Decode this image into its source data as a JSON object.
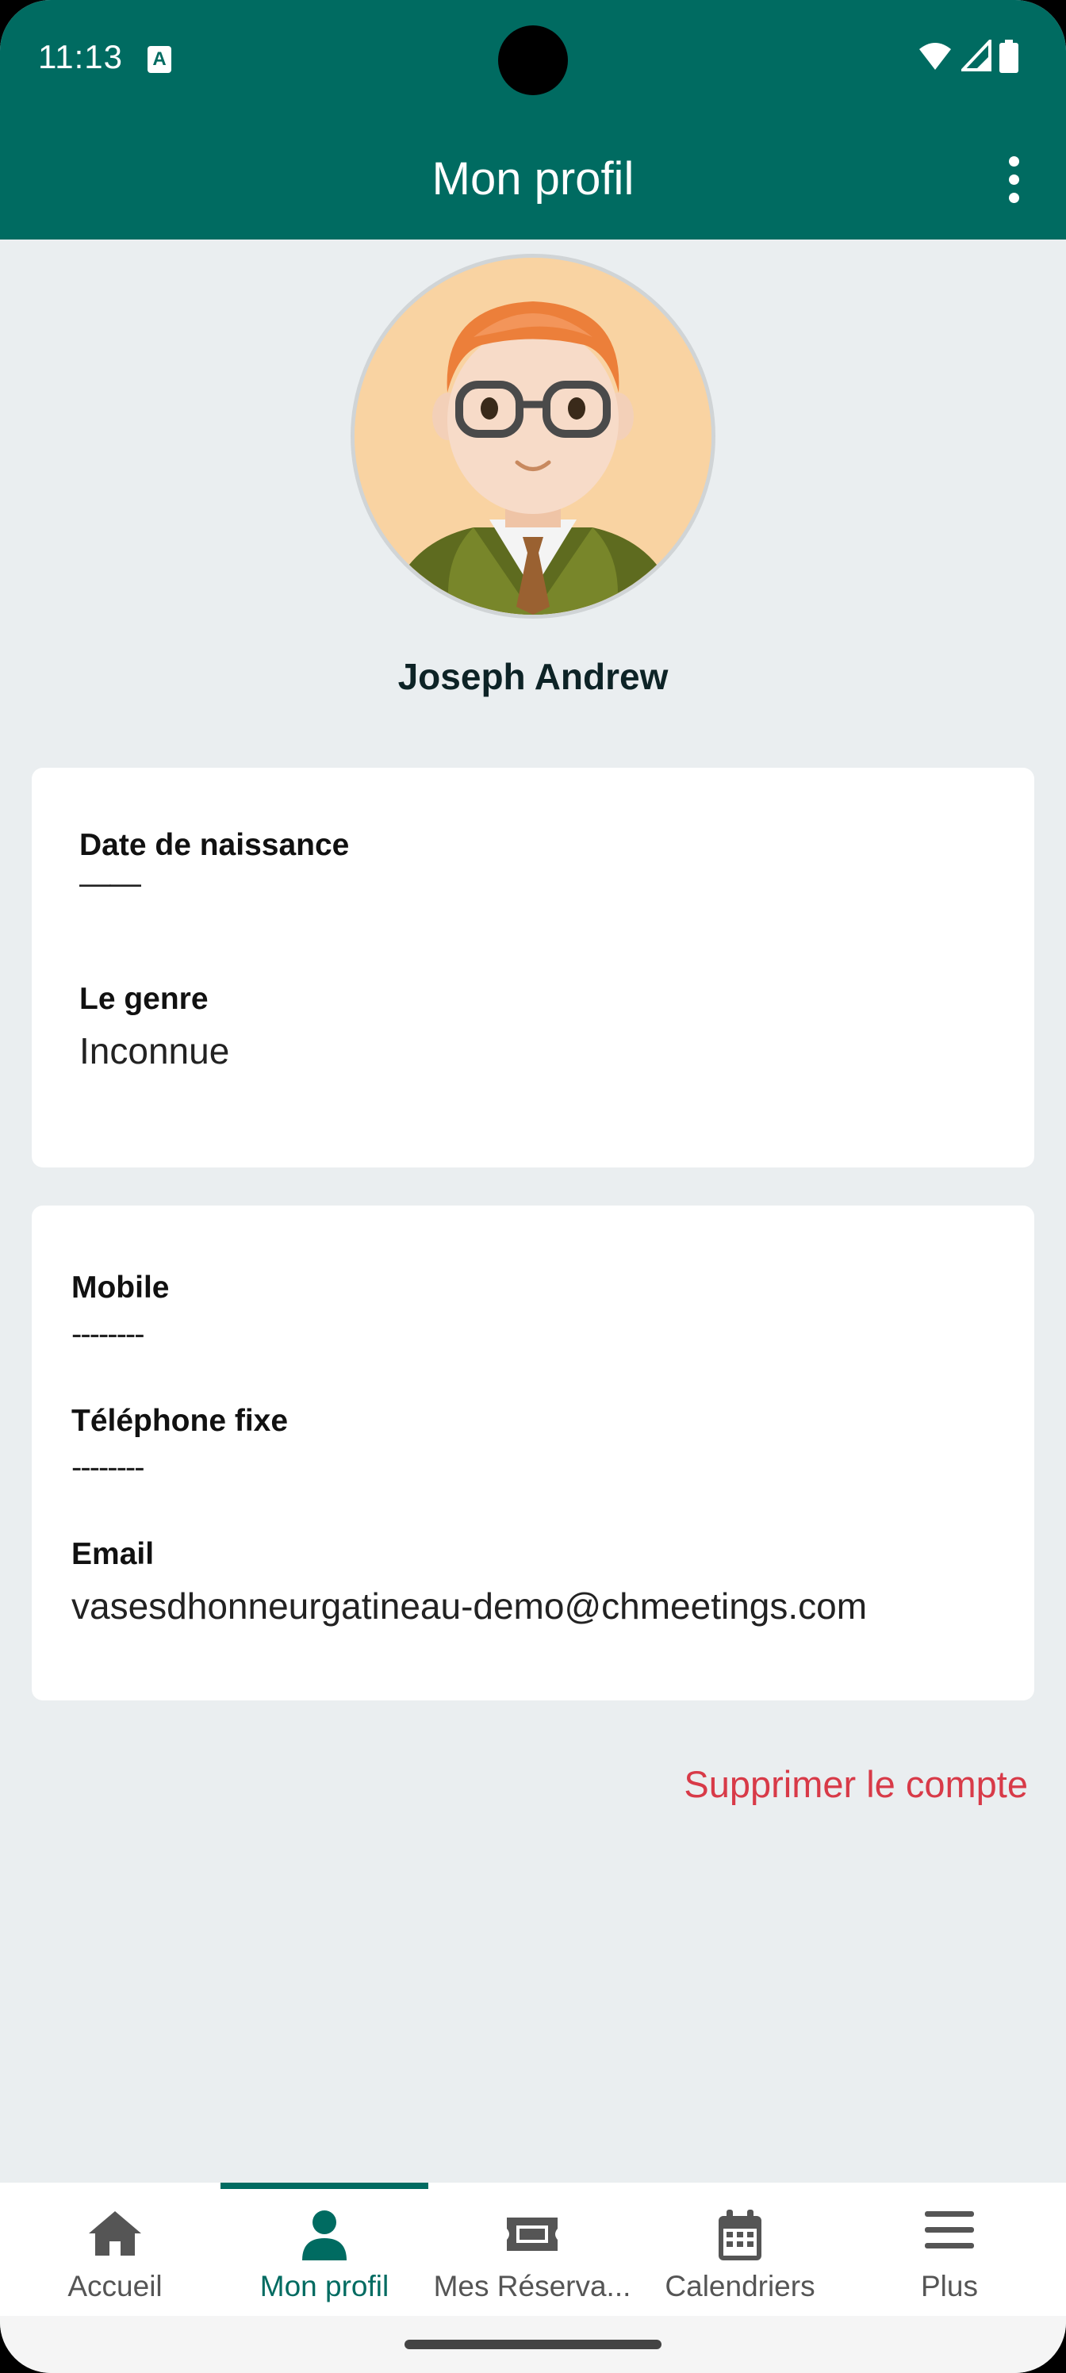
{
  "status_bar": {
    "time": "11:13",
    "notification_icon": "font-a-icon",
    "icons": [
      "wifi-icon",
      "signal-icon",
      "battery-icon"
    ]
  },
  "app_bar": {
    "title": "Mon profil",
    "menu_icon": "more-vert-icon"
  },
  "profile": {
    "name": "Joseph Andrew",
    "avatar": "avatar-illustration"
  },
  "card_personal": {
    "birth_label": "Date de naissance",
    "birth_value": "——",
    "gender_label": "Le genre",
    "gender_value": "Inconnue"
  },
  "card_contact": {
    "mobile_label": "Mobile",
    "mobile_value": "--------",
    "phone_label": "Téléphone fixe",
    "phone_value": "--------",
    "email_label": "Email",
    "email_value": "vasesdhonneurgatineau-demo@chmeetings.com"
  },
  "delete_account": "Supprimer le compte",
  "bottom_nav": {
    "items": [
      {
        "label": "Accueil",
        "icon": "home-icon"
      },
      {
        "label": "Mon profil",
        "icon": "person-icon"
      },
      {
        "label": "Mes Réserva...",
        "icon": "ticket-icon"
      },
      {
        "label": "Calendriers",
        "icon": "calendar-icon"
      },
      {
        "label": "Plus",
        "icon": "menu-icon"
      }
    ],
    "active_index": 1
  },
  "colors": {
    "primary": "#006b61",
    "background": "#eaeef0",
    "danger": "#d83a48"
  }
}
